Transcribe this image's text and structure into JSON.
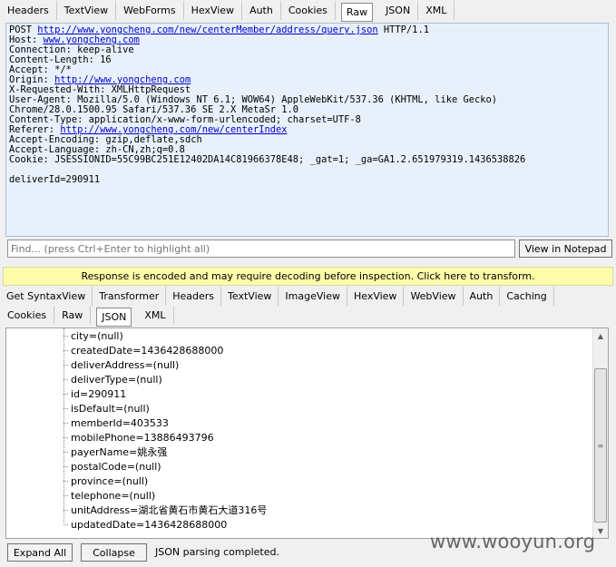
{
  "request_tabs": [
    {
      "label": "Headers",
      "active": false
    },
    {
      "label": "TextView",
      "active": false
    },
    {
      "label": "WebForms",
      "active": false
    },
    {
      "label": "HexView",
      "active": false
    },
    {
      "label": "Auth",
      "active": false
    },
    {
      "label": "Cookies",
      "active": false
    },
    {
      "label": "Raw",
      "active": true
    },
    {
      "label": "JSON",
      "active": false
    },
    {
      "label": "XML",
      "active": false
    }
  ],
  "request": {
    "method": "POST",
    "url": "http://www.yongcheng.com/new/centerMember/address/query.json",
    "protocol": "HTTP/1.1",
    "headers": [
      {
        "name": "Host",
        "value": "www.yongcheng.com",
        "is_link": true
      },
      {
        "name": "Connection",
        "value": "keep-alive",
        "is_link": false
      },
      {
        "name": "Content-Length",
        "value": "16",
        "is_link": false
      },
      {
        "name": "Accept",
        "value": "*/*",
        "is_link": false
      },
      {
        "name": "Origin",
        "value": "http://www.yongcheng.com",
        "is_link": true
      },
      {
        "name": "X-Requested-With",
        "value": "XMLHttpRequest",
        "is_link": false
      },
      {
        "name": "User-Agent",
        "value": "Mozilla/5.0 (Windows NT 6.1; WOW64) AppleWebKit/537.36 (KHTML, like Gecko)\nChrome/28.0.1500.95 Safari/537.36 SE 2.X MetaSr 1.0",
        "is_link": false
      },
      {
        "name": "Content-Type",
        "value": "application/x-www-form-urlencoded; charset=UTF-8",
        "is_link": false
      },
      {
        "name": "Referer",
        "value": "http://www.yongcheng.com/new/centerIndex",
        "is_link": true
      },
      {
        "name": "Accept-Encoding",
        "value": "gzip,deflate,sdch",
        "is_link": false
      },
      {
        "name": "Accept-Language",
        "value": "zh-CN,zh;q=0.8",
        "is_link": false
      },
      {
        "name": "Cookie",
        "value": "JSESSIONID=55C99BC251E12402DA14C81966378E48; _gat=1; _ga=GA1.2.651979319.1436538826",
        "is_link": false
      }
    ],
    "body": "deliverId=290911"
  },
  "find": {
    "placeholder": "Find... (press Ctrl+Enter to highlight all)",
    "button_label": "View in Notepad"
  },
  "banner_text": "Response is encoded and may require decoding before inspection. Click here to transform.",
  "response_tabs_row1": [
    {
      "label": "Get SyntaxView",
      "active": false
    },
    {
      "label": "Transformer",
      "active": false
    },
    {
      "label": "Headers",
      "active": false
    },
    {
      "label": "TextView",
      "active": false
    },
    {
      "label": "ImageView",
      "active": false
    },
    {
      "label": "HexView",
      "active": false
    },
    {
      "label": "WebView",
      "active": false
    },
    {
      "label": "Auth",
      "active": false
    },
    {
      "label": "Caching",
      "active": false
    }
  ],
  "response_tabs_row2": [
    {
      "label": "Cookies",
      "active": false
    },
    {
      "label": "Raw",
      "active": false
    },
    {
      "label": "JSON",
      "active": true
    },
    {
      "label": "XML",
      "active": false
    }
  ],
  "json_tree": [
    "city=(null)",
    "createdDate=1436428688000",
    "deliverAddress=(null)",
    "deliverType=(null)",
    "id=290911",
    "isDefault=(null)",
    "memberId=403533",
    "mobilePhone=13886493796",
    "payerName=姚永强",
    "postalCode=(null)",
    "province=(null)",
    "telephone=(null)",
    "unitAddress=湖北省黄石市黄石大道316号",
    "updatedDate=1436428688000"
  ],
  "bottom": {
    "expand_all_label": "Expand All",
    "collapse_label": "Collapse",
    "status": "JSON parsing completed."
  },
  "watermark": "www.wooyun.org"
}
